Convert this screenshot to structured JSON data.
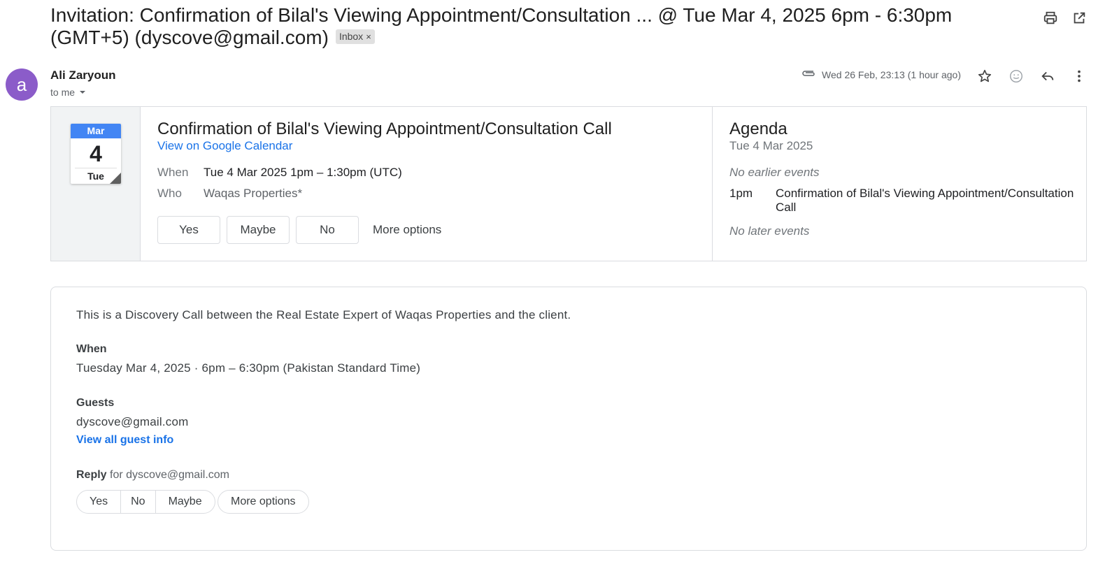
{
  "email": {
    "subject": "Invitation: Confirmation of Bilal's Viewing Appointment/Consultation ... @ Tue Mar 4, 2025 6pm - 6:30pm (GMT+5) (dyscove@gmail.com)",
    "label_chip": "Inbox",
    "label_chip_close": "×",
    "icons": {
      "print": "print-icon",
      "open_new_window": "open-in-new-window-icon"
    }
  },
  "sender": {
    "avatar_letter": "a",
    "avatar_color": "#8b5cc9",
    "name": "Ali Zaryoun",
    "to": "to me",
    "date": "Wed 26 Feb, 23:13 (1 hour ago)",
    "icons": [
      "attachment-icon",
      "star-icon",
      "emoji-icon",
      "reply-icon",
      "more-vert-icon"
    ]
  },
  "invite": {
    "cal_icon": {
      "month": "Mar",
      "day": "4",
      "weekday": "Tue"
    },
    "title": "Confirmation of Bilal's Viewing Appointment/Consultation Call",
    "calendar_link": "View on Google Calendar",
    "when_label": "When",
    "when_value": "Tue 4 Mar 2025 1pm – 1:30pm (UTC)",
    "who_label": "Who",
    "who_value": "Waqas Properties*",
    "rsvp": [
      "Yes",
      "Maybe",
      "No"
    ],
    "more_options": "More options"
  },
  "agenda": {
    "title": "Agenda",
    "date": "Tue 4 Mar 2025",
    "earlier": "No earlier events",
    "event_time": "1pm",
    "event_title": "Confirmation of Bilal's Viewing Appointment/Consultation Call",
    "later": "No later events"
  },
  "body": {
    "description": "This is a Discovery Call between the Real Estate Expert of Waqas Properties and the client.",
    "when_heading": "When",
    "when_value": "Tuesday Mar 4, 2025 · 6pm – 6:30pm (Pakistan Standard Time)",
    "guests_heading": "Guests",
    "guest_email": "dyscove@gmail.com",
    "guest_link": "View all guest info",
    "reply_label": "Reply",
    "reply_for": " for dyscove@gmail.com",
    "reply_options": [
      "Yes",
      "No",
      "Maybe"
    ],
    "more_options": "More options"
  },
  "colors": {
    "accent_blue": "#1a73e8",
    "calendar_blue": "#4285f4",
    "border": "#dadce0"
  }
}
